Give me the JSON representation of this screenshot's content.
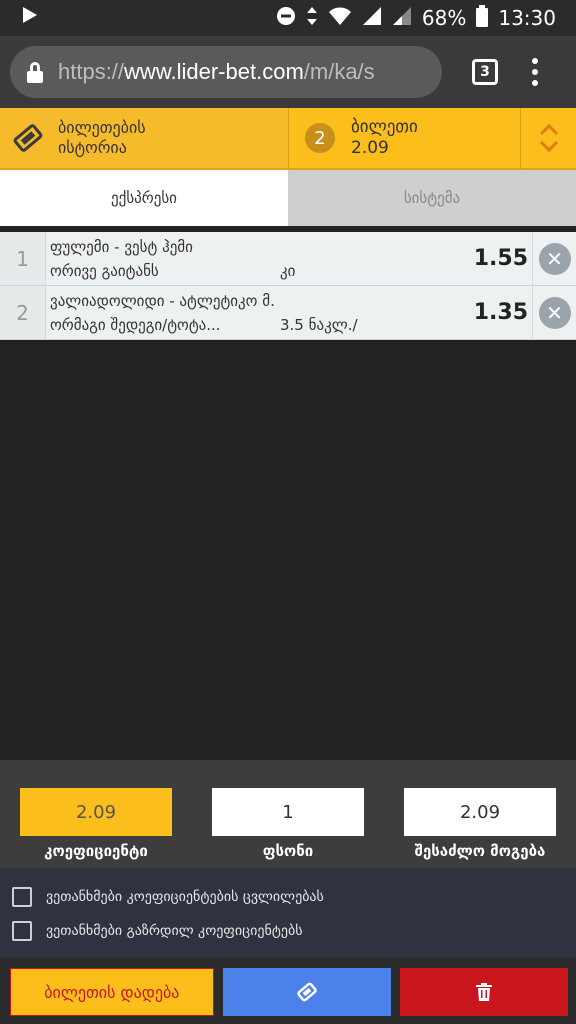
{
  "status": {
    "battery": "68%",
    "time": "13:30"
  },
  "browser": {
    "url_scheme": "https://",
    "url_host": "www.lider-bet.com",
    "url_path": "/m/ka/s",
    "tab_count": "3"
  },
  "header": {
    "history_label": "ბილეთების ისტორია",
    "ticket_count": "2",
    "ticket_label": "ბილეთი",
    "ticket_odds": "2.09"
  },
  "mode_tabs": {
    "express": "ექსპრესი",
    "system": "სისტემა"
  },
  "bets": [
    {
      "index": "1",
      "match": "ფულემი - ვესტ ჰემი",
      "market": "ორივე გაიტანს",
      "selection": "კი",
      "odds": "1.55"
    },
    {
      "index": "2",
      "match": "ვალიადოლიდი - ატლეტიკო მ.",
      "market": "ორმაგი შედეგი/ტოტა...",
      "selection": "3.5 ნაკლ./",
      "odds": "1.35"
    }
  ],
  "summary": {
    "coef_value": "2.09",
    "coef_label": "კოეფიციენტი",
    "stake_value": "1",
    "stake_label": "ფსონი",
    "win_value": "2.09",
    "win_label": "შესაძლო მოგება"
  },
  "options": {
    "accept_changes": "ვეთანხმები კოეფიციენტების ცვლილებას",
    "accept_increased": "ვეთანხმები გაზრდილ კოეფიციენტებს"
  },
  "actions": {
    "place_label": "ბილეთის დადება"
  },
  "colors": {
    "accent": "#fbbe1b",
    "danger": "#c8161c",
    "share": "#4b81e8"
  }
}
